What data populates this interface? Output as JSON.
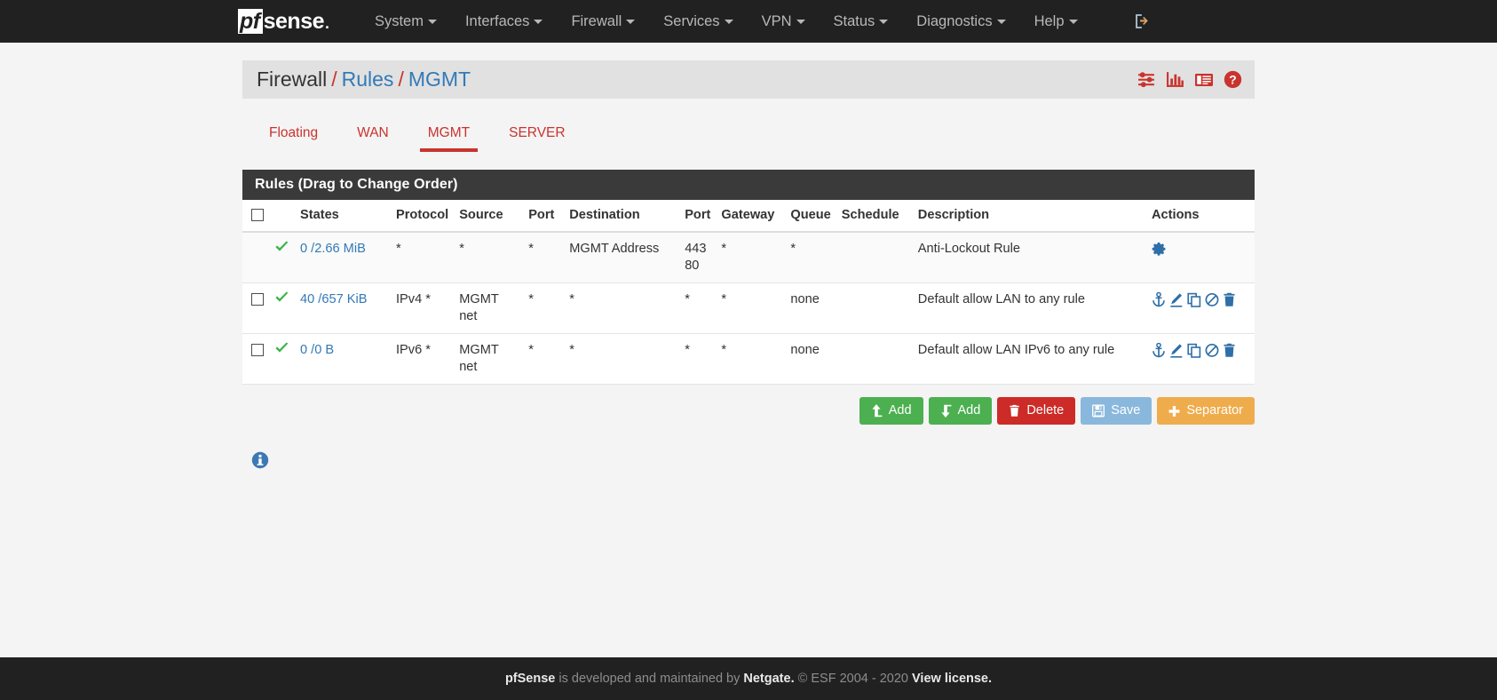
{
  "navbar": {
    "brand": {
      "pf": "pf",
      "sense": "sense"
    },
    "items": [
      {
        "label": "System",
        "caret": true
      },
      {
        "label": "Interfaces",
        "caret": true
      },
      {
        "label": "Firewall",
        "caret": true
      },
      {
        "label": "Services",
        "caret": true
      },
      {
        "label": "VPN",
        "caret": true
      },
      {
        "label": "Status",
        "caret": true
      },
      {
        "label": "Diagnostics",
        "caret": true
      },
      {
        "label": "Help",
        "caret": true
      }
    ],
    "logout_icon": "logout-icon"
  },
  "breadcrumb": {
    "part1": "Firewall",
    "sep1": "/",
    "part2": "Rules",
    "sep2": "/",
    "part3": "MGMT",
    "icons": [
      {
        "name": "advanced-filter-icon"
      },
      {
        "name": "bar-chart-icon"
      },
      {
        "name": "log-list-icon"
      },
      {
        "name": "help-circle-icon"
      }
    ]
  },
  "tabs": [
    {
      "label": "Floating",
      "active": false
    },
    {
      "label": "WAN",
      "active": false
    },
    {
      "label": "MGMT",
      "active": true
    },
    {
      "label": "SERVER",
      "active": false
    }
  ],
  "panel": {
    "title": "Rules (Drag to Change Order)",
    "columns": {
      "checkbox": "",
      "state": "",
      "states": "States",
      "protocol": "Protocol",
      "source": "Source",
      "port_src": "Port",
      "destination": "Destination",
      "port_dst": "Port",
      "gateway": "Gateway",
      "queue": "Queue",
      "schedule": "Schedule",
      "description": "Description",
      "actions": "Actions"
    },
    "rows": [
      {
        "has_checkbox": false,
        "status": "pass-check-icon",
        "states": "0 /2.66 MiB",
        "protocol": "*",
        "source": "*",
        "port_src": "*",
        "destination": "MGMT Address",
        "port_dst": "443\n80",
        "gateway": "*",
        "queue": "*",
        "schedule": "",
        "description": "Anti-Lockout Rule",
        "actions": [
          "gear-icon"
        ]
      },
      {
        "has_checkbox": true,
        "status": "pass-check-icon",
        "states": "40 /657 KiB",
        "protocol": "IPv4 *",
        "source": "MGMT net",
        "port_src": "*",
        "destination": "*",
        "port_dst": "*",
        "gateway": "*",
        "queue": "none",
        "schedule": "",
        "description": "Default allow LAN to any rule",
        "actions": [
          "anchor-icon",
          "pencil-icon",
          "copy-icon",
          "ban-icon",
          "trash-icon"
        ]
      },
      {
        "has_checkbox": true,
        "status": "pass-check-icon",
        "states": "0 /0 B",
        "protocol": "IPv6 *",
        "source": "MGMT net",
        "port_src": "*",
        "destination": "*",
        "port_dst": "*",
        "gateway": "*",
        "queue": "none",
        "schedule": "",
        "description": "Default allow LAN IPv6 to any rule",
        "actions": [
          "anchor-icon",
          "pencil-icon",
          "copy-icon",
          "ban-icon",
          "trash-icon"
        ]
      }
    ]
  },
  "buttons": [
    {
      "label": "Add",
      "icon": "arrow-up-icon",
      "color": "#4caf50"
    },
    {
      "label": "Add",
      "icon": "arrow-down-icon",
      "color": "#4caf50"
    },
    {
      "label": "Delete",
      "icon": "trash-icon",
      "color": "#cc2b28"
    },
    {
      "label": "Save",
      "icon": "save-floppy-icon",
      "color": "#8ab8dd"
    },
    {
      "label": "Separator",
      "icon": "plus-icon",
      "color": "#efac4c"
    }
  ],
  "info_icon": "info-circle-icon",
  "footer": {
    "brand": "pfSense",
    "text1": " is developed and maintained by ",
    "netgate": "Netgate.",
    "text2": " © ESF 2004 - 2020 ",
    "license": "View license."
  },
  "colors": {
    "navbar_bg": "#212121",
    "accent_red": "#c9332e",
    "link_blue": "#337ab7",
    "pass_green": "#4caf50",
    "panel_header": "#3a3a3a",
    "page_bg": "#f4f4f4"
  }
}
